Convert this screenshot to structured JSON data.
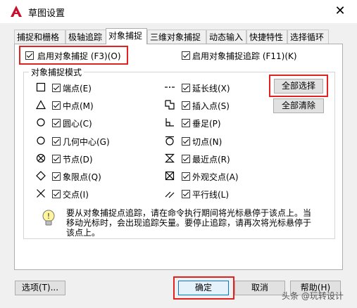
{
  "window": {
    "title": "草图设置",
    "close": "✕"
  },
  "tabs": [
    {
      "label": "捕捉和栅格"
    },
    {
      "label": "极轴追踪"
    },
    {
      "label": "对象捕捉"
    },
    {
      "label": "三维对象捕捉"
    },
    {
      "label": "动态输入"
    },
    {
      "label": "快捷特性"
    },
    {
      "label": "选择循环"
    }
  ],
  "top_options": {
    "enable_snap": "启用对象捕捉 (F3)(O)",
    "enable_tracking": "启用对象捕捉追踪 (F11)(K)"
  },
  "group": {
    "title": "对象捕捉模式"
  },
  "snaps_left": [
    {
      "label": "端点(E)",
      "icon": "square-icon"
    },
    {
      "label": "中点(M)",
      "icon": "triangle-icon"
    },
    {
      "label": "圆心(C)",
      "icon": "circle-icon"
    },
    {
      "label": "几何中心(G)",
      "icon": "circle-icon"
    },
    {
      "label": "节点(D)",
      "icon": "circle-x-icon"
    },
    {
      "label": "象限点(Q)",
      "icon": "diamond-icon"
    },
    {
      "label": "交点(I)",
      "icon": "x-icon"
    }
  ],
  "snaps_right": [
    {
      "label": "延长线(X)",
      "icon": "dash-dot-icon"
    },
    {
      "label": "插入点(S)",
      "icon": "insert-icon"
    },
    {
      "label": "垂足(P)",
      "icon": "perpendicular-icon"
    },
    {
      "label": "切点(N)",
      "icon": "tangent-icon"
    },
    {
      "label": "最近点(R)",
      "icon": "hourglass-icon"
    },
    {
      "label": "外观交点(A)",
      "icon": "box-x-icon"
    },
    {
      "label": "平行线(L)",
      "icon": "parallel-icon"
    }
  ],
  "buttons": {
    "select_all": "全部选择",
    "clear_all": "全部清除",
    "options": "选项(T)...",
    "ok": "确定",
    "cancel": "取消",
    "help": "帮助(H)"
  },
  "info": "要从对象捕捉点追踪，请在命令执行期间将光标悬停于该点上。当移动光标时，会出现追踪矢量。要停止追踪，请再次将光标悬停于该点上。",
  "watermark": "头条 @玩转设计",
  "colors": {
    "highlight": "#e22121",
    "accent": "#0078d7",
    "app_icon": "#c8102e"
  }
}
